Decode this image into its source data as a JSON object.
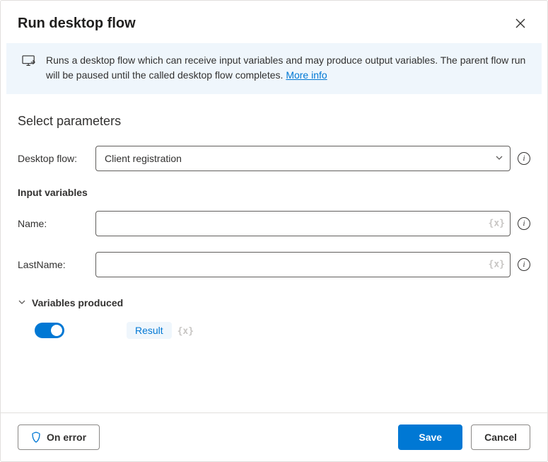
{
  "header": {
    "title": "Run desktop flow"
  },
  "banner": {
    "text": "Runs a desktop flow which can receive input variables and may produce output variables. The parent flow run will be paused until the called desktop flow completes. ",
    "link_label": "More info"
  },
  "params": {
    "section_title": "Select parameters",
    "desktop_flow_label": "Desktop flow:",
    "desktop_flow_value": "Client registration",
    "input_vars_title": "Input variables",
    "name_label": "Name:",
    "name_value": "",
    "lastname_label": "LastName:",
    "lastname_value": "",
    "var_token": "{x}"
  },
  "produced": {
    "title": "Variables produced",
    "result_label": "Result",
    "vx": "{x}"
  },
  "footer": {
    "on_error": "On error",
    "save": "Save",
    "cancel": "Cancel"
  }
}
